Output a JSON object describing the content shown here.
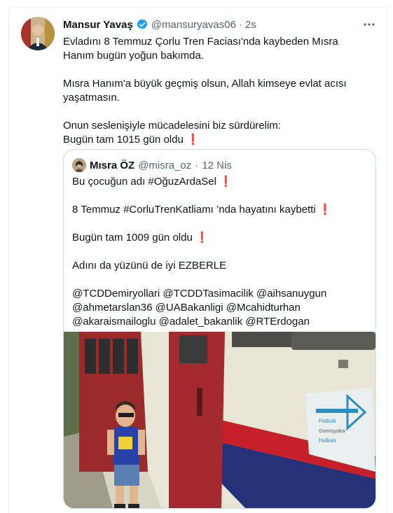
{
  "tweet": {
    "author_name": "Mansur Yavaş",
    "author_handle": "@mansuryavas06",
    "separator": "·",
    "time": "2s",
    "lines": [
      "Evladını 8 Temmuz Çorlu Tren Faciası'nda kaybeden Mısra",
      "Hanım bugün yoğun bakımda.",
      "",
      "Mısra Hanım'a büyük geçmiş olsun, Allah kimseye evlat acısı",
      "yaşatmasın.",
      "",
      "Onun seslenişiyle mücadelesini biz sürdürelim:"
    ],
    "last_line": "Bugün tam 1015 gün oldu",
    "exclamation": "❗"
  },
  "quoted_tweet": {
    "author_name": "Mısra ÖZ",
    "author_handle": "@misra_oz",
    "separator": "·",
    "time": "12 Nis",
    "line1": "Bu çocuğun adı #OğuzArdaSel",
    "line2": "8 Temmuz #CorluTrenKatliamı ’nda hayatını kaybetti",
    "line3": "Bugün tam 1009 gün  oldu",
    "line4": "Adını da yüzünü de iyi EZBERLE",
    "mentions": [
      "@TCDDemiryollari @TCDDTasimacilik @aihsanuygun",
      "@ahmetarslan36 @UABakanligi @Mcahidturhan",
      "@akaraismailoglu @adalet_bakanlik @RTErdogan"
    ],
    "exclamation": "❗",
    "sign_text_1": "Halkalı",
    "sign_text_2": "Gümüşyaka",
    "sign_text_3": "Halkalı"
  },
  "colors": {
    "verified": "#1d9bf0",
    "secondary_text": "#536471",
    "exclamation": "#e0162b",
    "border": "#cfd9de"
  }
}
